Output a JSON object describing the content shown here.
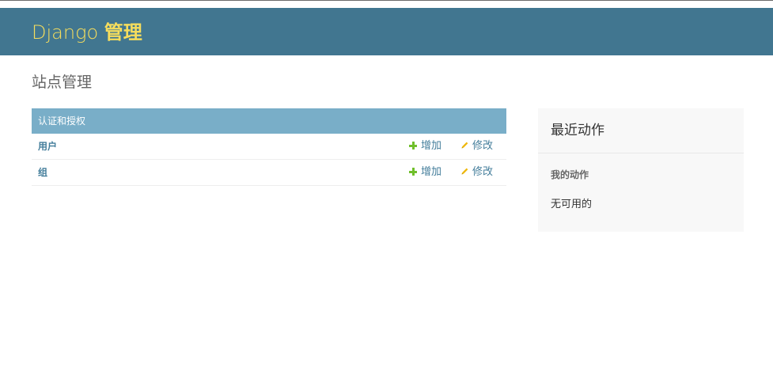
{
  "header": {
    "brand_prefix": "Django",
    "brand_suffix": "管理"
  },
  "page_title": "站点管理",
  "app_module": {
    "caption": "认证和授权",
    "models": [
      {
        "name": "用户",
        "add_label": "增加",
        "change_label": "修改"
      },
      {
        "name": "组",
        "add_label": "增加",
        "change_label": "修改"
      }
    ]
  },
  "recent_actions": {
    "title": "最近动作",
    "subtitle": "我的动作",
    "empty_text": "无可用的"
  },
  "colors": {
    "header_bg": "#417690",
    "brand_text": "#f5dd5d",
    "caption_bg": "#79aec8",
    "link": "#447e9b",
    "add_icon": "#70bf2b",
    "change_icon": "#efb80b"
  },
  "icons": {
    "add": "plus-icon",
    "change": "pencil-icon"
  }
}
